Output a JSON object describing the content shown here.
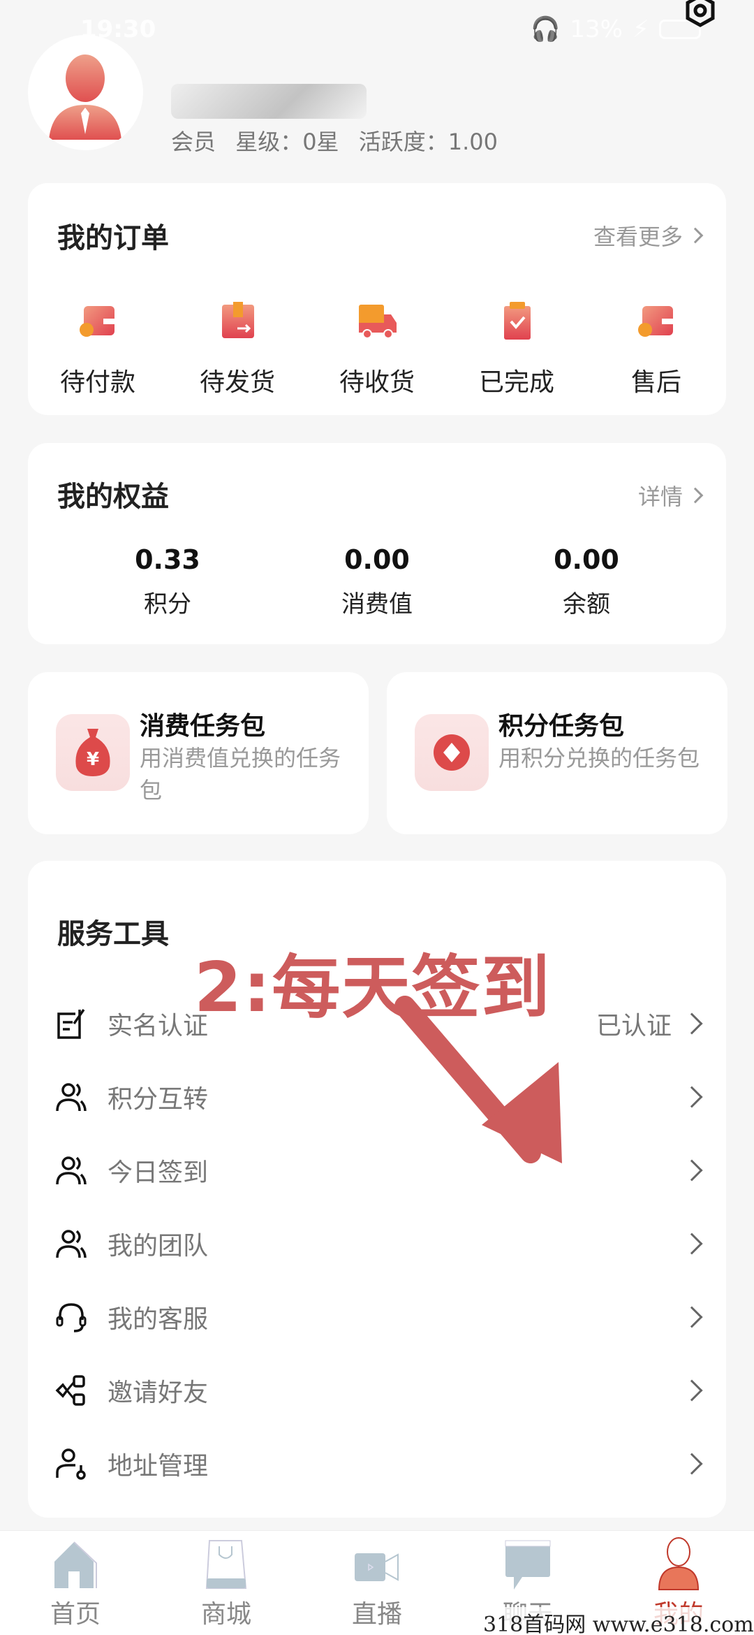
{
  "status_bar": {
    "time": "19:30",
    "battery": "13%"
  },
  "profile": {
    "member_label": "会员",
    "star_level": "星级：0星",
    "activity": "活跃度：1.00"
  },
  "orders": {
    "title": "我的订单",
    "more_label": "查看更多",
    "items": [
      {
        "label": "待付款",
        "icon": "wallet-icon"
      },
      {
        "label": "待发货",
        "icon": "package-icon"
      },
      {
        "label": "待收货",
        "icon": "truck-icon"
      },
      {
        "label": "已完成",
        "icon": "clipboard-check-icon"
      },
      {
        "label": "售后",
        "icon": "wallet-icon"
      }
    ]
  },
  "benefits": {
    "title": "我的权益",
    "detail_label": "详情",
    "items": [
      {
        "value": "0.33",
        "label": "积分"
      },
      {
        "value": "0.00",
        "label": "消费值"
      },
      {
        "value": "0.00",
        "label": "余额"
      }
    ]
  },
  "task_packs": [
    {
      "title": "消费任务包",
      "desc": "用消费值兑换的任务包",
      "icon": "money-bag-icon"
    },
    {
      "title": "积分任务包",
      "desc": "用积分兑换的任务包",
      "icon": "coin-icon"
    }
  ],
  "tools": {
    "title": "服务工具",
    "items": [
      {
        "label": "实名认证",
        "value": "已认证",
        "icon": "edit-document-icon"
      },
      {
        "label": "积分互转",
        "value": "",
        "icon": "users-icon"
      },
      {
        "label": "今日签到",
        "value": "",
        "icon": "users-icon"
      },
      {
        "label": "我的团队",
        "value": "",
        "icon": "users-icon"
      },
      {
        "label": "我的客服",
        "value": "",
        "icon": "headset-icon"
      },
      {
        "label": "邀请好友",
        "value": "",
        "icon": "share-icon"
      },
      {
        "label": "地址管理",
        "value": "",
        "icon": "user-key-icon"
      }
    ]
  },
  "annotation": {
    "text": "2:每天签到",
    "color": "#cd5c5c"
  },
  "tabbar": {
    "active_color": "#c0392b",
    "items": [
      {
        "label": "首页",
        "icon": "home-icon"
      },
      {
        "label": "商城",
        "icon": "shopping-bag-icon"
      },
      {
        "label": "直播",
        "icon": "video-camera-icon"
      },
      {
        "label": "聊天",
        "icon": "chat-bubble-icon"
      },
      {
        "label": "我的",
        "icon": "user-icon",
        "active": true
      }
    ]
  },
  "watermark": "318首码网   www.e318.com"
}
